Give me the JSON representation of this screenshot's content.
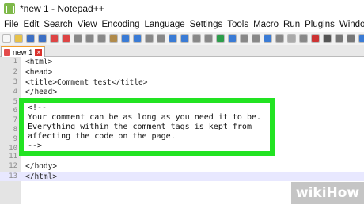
{
  "window": {
    "title": "*new 1 - Notepad++"
  },
  "menu": [
    "File",
    "Edit",
    "Search",
    "View",
    "Encoding",
    "Language",
    "Settings",
    "Tools",
    "Macro",
    "Run",
    "Plugins",
    "Window",
    "?"
  ],
  "toolbar_icons": [
    "new-file-icon",
    "open-icon",
    "save-icon",
    "save-all-icon",
    "close-icon",
    "close-all-icon",
    "print-icon",
    "cut-icon",
    "copy-icon",
    "paste-icon",
    "undo-icon",
    "redo-icon",
    "find-icon",
    "replace-icon",
    "zoom-in-icon",
    "zoom-out-icon",
    "sync-v-icon",
    "sync-h-icon",
    "wrap-icon",
    "all-chars-icon",
    "indent-guide-icon",
    "lang-icon",
    "doc-map-icon",
    "function-list-icon",
    "folder-icon",
    "monitor-icon",
    "record-icon",
    "stop-icon",
    "play-icon",
    "play-multi-icon",
    "save-macro-icon"
  ],
  "tab": {
    "label": "new 1"
  },
  "editor": {
    "lines": [
      {
        "n": "1",
        "text": "<html>"
      },
      {
        "n": "2",
        "text": "<head>"
      },
      {
        "n": "3",
        "text": "<title>Comment test</title>"
      },
      {
        "n": "4",
        "text": "</head>"
      },
      {
        "n": "5",
        "text": ""
      },
      {
        "n": "6",
        "text": ""
      },
      {
        "n": "7",
        "text": ""
      },
      {
        "n": "8",
        "text": ""
      },
      {
        "n": "9",
        "text": ""
      },
      {
        "n": "10",
        "text": ""
      },
      {
        "n": "11",
        "text": ""
      },
      {
        "n": "12",
        "text": "</body>"
      },
      {
        "n": "13",
        "text": "</html>"
      }
    ],
    "comment": [
      "<!--",
      "Your comment can be as long as you need it to be.",
      "Everything within the comment tags is kept from",
      "affecting the code on the page.",
      "-->"
    ],
    "current_line": 13
  },
  "watermark": "wikiHow",
  "colors": {
    "highlight_border": "#22e322",
    "tab_accent": "#f39c27"
  }
}
